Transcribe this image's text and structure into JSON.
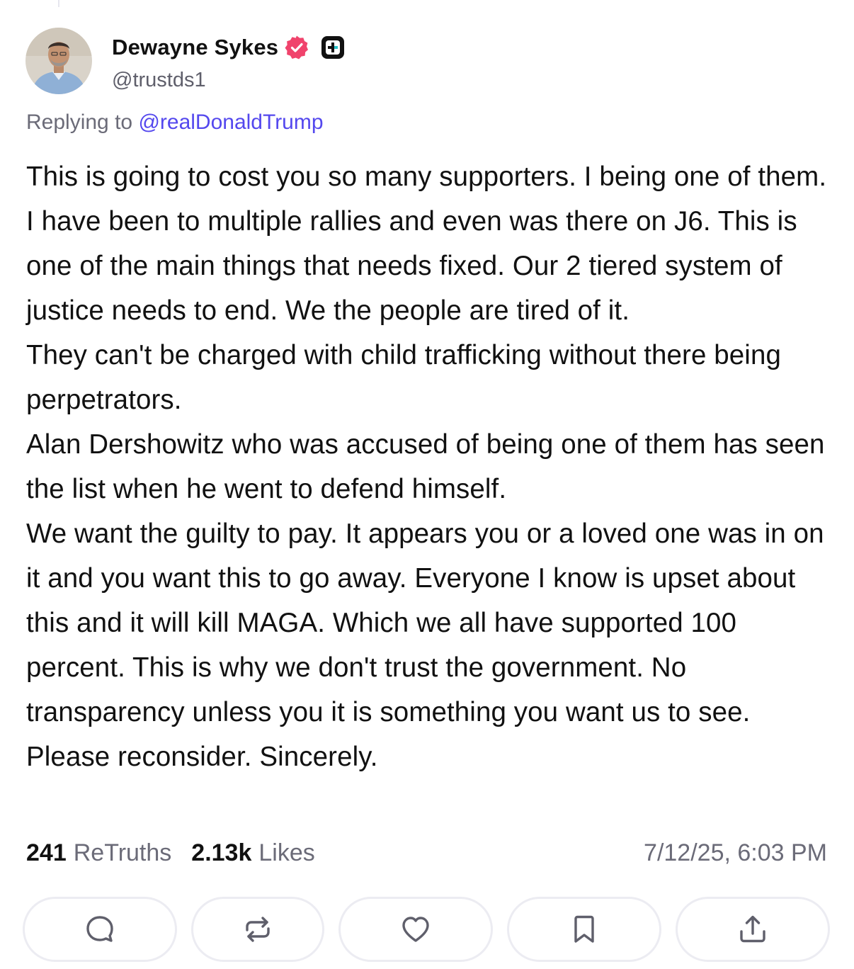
{
  "post": {
    "author": {
      "display_name": "Dewayne Sykes",
      "handle": "@trustds1",
      "verified_badge_color": "#f0436c"
    },
    "replying_prefix": "Replying to ",
    "replying_to": "@realDonaldTrump",
    "body": "This is going to cost you so many supporters. I being one of them. I have been to multiple rallies and even was there on J6.  This is one of the main things that needs fixed. Our 2 tiered system of justice needs to end. We the people are tired of it.\n They can't be charged with child trafficking without there being perpetrators.\n Alan Dershowitz who was accused of being one of them has seen the list when he went to defend himself.\n We want the guilty to pay. It appears you or a loved one was in on it and you want this to go away. Everyone I know is upset about this and it will kill MAGA. Which we all have supported 100 percent. This is why we don't trust the government. No transparency unless you it is something you want us to see. Please reconsider. Sincerely.",
    "stats": {
      "retruths_count": "241",
      "retruths_label": "ReTruths",
      "likes_count": "2.13k",
      "likes_label": "Likes"
    },
    "timestamp": "7/12/25, 6:03 PM"
  },
  "actions": [
    {
      "name": "reply",
      "icon": "comment-icon"
    },
    {
      "name": "retruth",
      "icon": "repost-icon"
    },
    {
      "name": "like",
      "icon": "heart-icon"
    },
    {
      "name": "bookmark",
      "icon": "bookmark-icon"
    },
    {
      "name": "share",
      "icon": "share-icon"
    }
  ],
  "colors": {
    "mention": "#5448ee",
    "muted_text": "#6b6b78",
    "action_border": "#ececf2"
  }
}
